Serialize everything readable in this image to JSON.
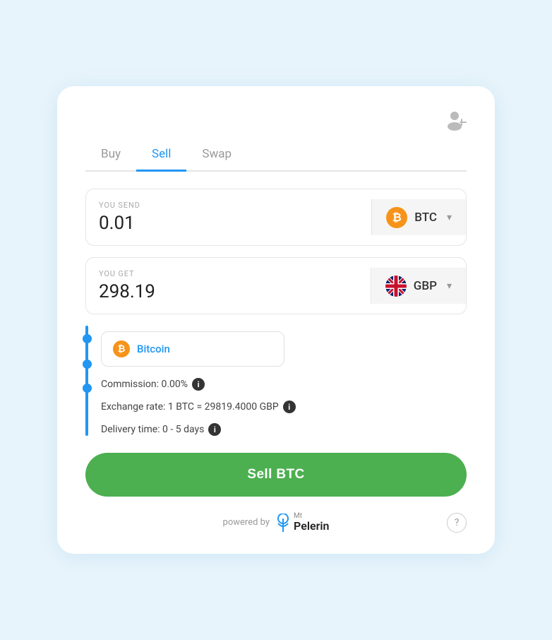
{
  "tabs": [
    {
      "id": "buy",
      "label": "Buy",
      "active": false
    },
    {
      "id": "sell",
      "label": "Sell",
      "active": true
    },
    {
      "id": "swap",
      "label": "Swap",
      "active": false
    }
  ],
  "send": {
    "label": "YOU SEND",
    "value": "0.01",
    "currency_code": "BTC",
    "currency_label": "Bitcoin"
  },
  "receive": {
    "label": "YOU GET",
    "value": "298.19",
    "currency_code": "GBP"
  },
  "selected_coin": {
    "name": "Bitcoin"
  },
  "details": {
    "commission": "Commission: 0.00%",
    "exchange_rate": "Exchange rate: 1 BTC = 29819.4000 GBP",
    "delivery_time": "Delivery time: 0 - 5 days"
  },
  "sell_button": "Sell BTC",
  "footer": {
    "powered_by": "powered by",
    "brand_name": "Pelerin",
    "brand_prefix": "Mt"
  },
  "icons": {
    "user": "👤",
    "info": "i",
    "help": "?",
    "chevron": "▾"
  }
}
